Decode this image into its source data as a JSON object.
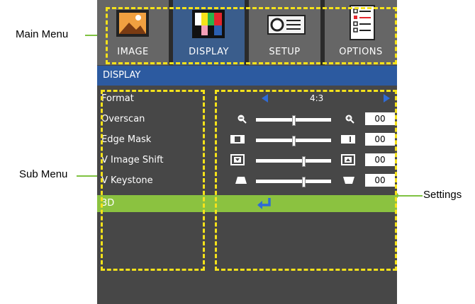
{
  "callouts": {
    "main_menu": "Main Menu",
    "sub_menu": "Sub Menu",
    "settings": "Settings"
  },
  "main_menu": {
    "tabs": [
      {
        "label": "IMAGE",
        "icon": "image-icon",
        "selected": false
      },
      {
        "label": "DISPLAY",
        "icon": "display-icon",
        "selected": true
      },
      {
        "label": "SETUP",
        "icon": "setup-icon",
        "selected": false
      },
      {
        "label": "OPTIONS",
        "icon": "options-icon",
        "selected": false
      }
    ]
  },
  "submenu": {
    "title": "DISPLAY",
    "items": [
      {
        "label": "Format",
        "value": "4:3"
      },
      {
        "label": "Overscan",
        "value": "00"
      },
      {
        "label": "Edge Mask",
        "value": "00"
      },
      {
        "label": "V Image Shift",
        "value": "00"
      },
      {
        "label": "V Keystone",
        "value": "00"
      },
      {
        "label": "3D",
        "icon": "enter-icon"
      }
    ]
  },
  "sliders": {
    "overscan": 0.5,
    "edge_mask": 0.5,
    "v_image_shift": 0.63,
    "v_keystone": 0.63
  },
  "colors": {
    "selected_tab": "#3a5d8c",
    "title_bar": "#2c5aa0",
    "highlight": "#8bc240",
    "dashed_outline": "#f5e21a",
    "callout_line": "#7fc241"
  }
}
